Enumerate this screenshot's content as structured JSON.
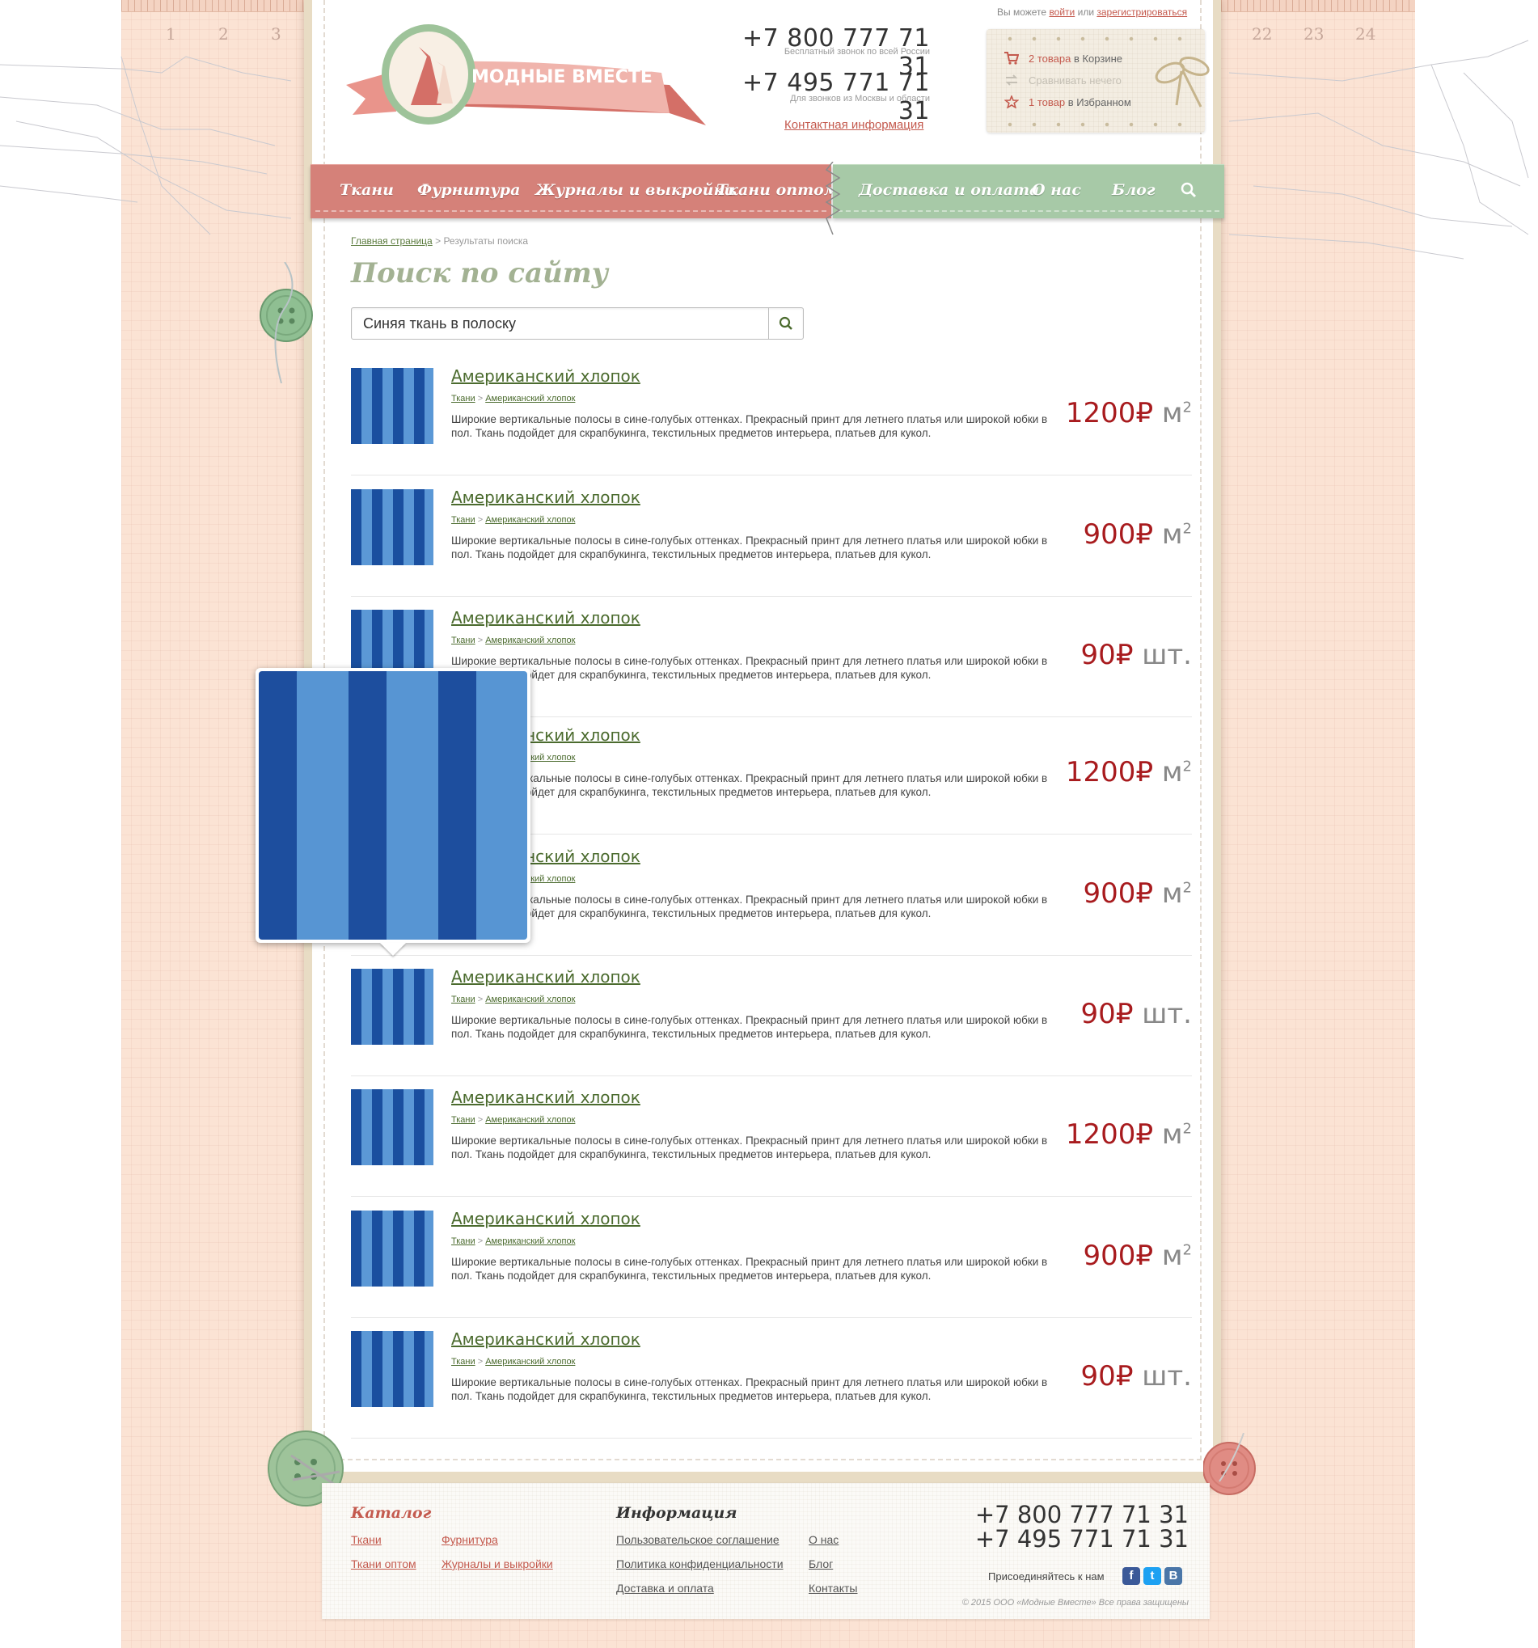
{
  "ruler": {
    "numbers": [
      "1",
      "2",
      "3",
      "22",
      "23",
      "24"
    ]
  },
  "header": {
    "brand": "МОДНЫЕ ВМЕСТЕ",
    "phone1": "+7 800 777 71 31",
    "phone1_note": "Бесплатный звонок по всей России",
    "phone2": "+7 495 771 71 31",
    "phone2_note": "Для звонков из Москвы и области",
    "contact_link": "Контактная информация",
    "auth_prefix": "Вы можете",
    "auth_login": "войти",
    "auth_or": "или",
    "auth_register": "зарегистрироваться"
  },
  "minipanel": {
    "cart_count": "2 товара",
    "cart_text": "в Корзине",
    "compare_text": "Сравнивать нечего",
    "fav_count": "1 товар",
    "fav_text": "в Избранном"
  },
  "nav": {
    "left": [
      "Ткани",
      "Фурнитура",
      "Журналы и выкройки",
      "Ткани оптом"
    ],
    "right": [
      "Доставка и оплата",
      "О нас",
      "Блог"
    ]
  },
  "breadcrumb": {
    "home": "Главная страница",
    "sep": ">",
    "current": "Результаты поиска"
  },
  "page_title": "Поиск по сайту",
  "search": {
    "value": "Синяя ткань в полоску"
  },
  "results": [
    {
      "title": "Американский хлопок",
      "crumb_a": "Ткани",
      "crumb_b": "Американский хлопок",
      "desc": "Широкие вертикальные полосы в сине-голубых оттенках. Прекрасный принт для летнего платья или широкой юбки в пол. Ткань подойдет для скрапбукинга, текстильных предметов интерьера, платьев для кукол.",
      "price": "1200",
      "currency": "₽",
      "unit": "м",
      "unit_sup": "2"
    },
    {
      "title": "Американский хлопок",
      "crumb_a": "Ткани",
      "crumb_b": "Американский хлопок",
      "desc": "Широкие вертикальные полосы в сине-голубых оттенках. Прекрасный принт для летнего платья или широкой юбки в пол. Ткань подойдет для скрапбукинга, текстильных предметов интерьера, платьев для кукол.",
      "price": "900",
      "currency": "₽",
      "unit": "м",
      "unit_sup": "2"
    },
    {
      "title": "Американский хлопок",
      "crumb_a": "Ткани",
      "crumb_b": "Американский хлопок",
      "desc": "Широкие вертикальные полосы в сине-голубых оттенках. Прекрасный принт для летнего платья или широкой юбки в пол. Ткань подойдет для скрапбукинга, текстильных предметов интерьера, платьев для кукол.",
      "price": "90",
      "currency": "₽",
      "unit": "шт.",
      "unit_sup": ""
    },
    {
      "title": "Американский хлопок",
      "crumb_a": "Ткани",
      "crumb_b": "Американский хлопок",
      "desc": "Широкие вертикальные полосы в сине-голубых оттенках. Прекрасный принт для летнего платья или широкой юбки в пол. Ткань подойдет для скрапбукинга, текстильных предметов интерьера, платьев для кукол.",
      "price": "1200",
      "currency": "₽",
      "unit": "м",
      "unit_sup": "2"
    },
    {
      "title": "Американский хлопок",
      "crumb_a": "Ткани",
      "crumb_b": "Американский хлопок",
      "desc": "Широкие вертикальные полосы в сине-голубых оттенках. Прекрасный принт для летнего платья или широкой юбки в пол. Ткань подойдет для скрапбукинга, текстильных предметов интерьера, платьев для кукол.",
      "price": "900",
      "currency": "₽",
      "unit": "м",
      "unit_sup": "2"
    },
    {
      "title": "Американский хлопок",
      "crumb_a": "Ткани",
      "crumb_b": "Американский хлопок",
      "desc": "Широкие вертикальные полосы в сине-голубых оттенках. Прекрасный принт для летнего платья или широкой юбки в пол. Ткань подойдет для скрапбукинга, текстильных предметов интерьера, платьев для кукол.",
      "price": "90",
      "currency": "₽",
      "unit": "шт.",
      "unit_sup": ""
    },
    {
      "title": "Американский хлопок",
      "crumb_a": "Ткани",
      "crumb_b": "Американский хлопок",
      "desc": "Широкие вертикальные полосы в сине-голубых оттенках. Прекрасный принт для летнего платья или широкой юбки в пол. Ткань подойдет для скрапбукинга, текстильных предметов интерьера, платьев для кукол.",
      "price": "1200",
      "currency": "₽",
      "unit": "м",
      "unit_sup": "2"
    },
    {
      "title": "Американский хлопок",
      "crumb_a": "Ткани",
      "crumb_b": "Американский хлопок",
      "desc": "Широкие вертикальные полосы в сине-голубых оттенках. Прекрасный принт для летнего платья или широкой юбки в пол. Ткань подойдет для скрапбукинга, текстильных предметов интерьера, платьев для кукол.",
      "price": "900",
      "currency": "₽",
      "unit": "м",
      "unit_sup": "2"
    },
    {
      "title": "Американский хлопок",
      "crumb_a": "Ткани",
      "crumb_b": "Американский хлопок",
      "desc": "Широкие вертикальные полосы в сине-голубых оттенках. Прекрасный принт для летнего платья или широкой юбки в пол. Ткань подойдет для скрапбукинга, текстильных предметов интерьера, платьев для кукол.",
      "price": "90",
      "currency": "₽",
      "unit": "шт.",
      "unit_sup": ""
    }
  ],
  "footer": {
    "catalog_head": "Каталог",
    "catalog_links": [
      "Ткани",
      "Фурнитура",
      "Ткани оптом",
      "Журналы и выкройки"
    ],
    "info_head": "Информация",
    "info_links": [
      "Пользовательское соглашение",
      "Политика конфиденциальности",
      "Доставка и оплата",
      "О нас",
      "Блог",
      "Контакты"
    ],
    "phone1": "+7 800 777 71 31",
    "phone2": "+7 495 771 71 31",
    "social_label": "Присоединяйтесь к нам",
    "copyright": "© 2015 ООО «Модные Вместе» Все права защищены"
  },
  "colors": {
    "accent_red": "#c45a4e",
    "price_red": "#a81b1e",
    "nav_pink": "#d58179",
    "nav_green": "#a7c9a7",
    "link_green": "#4b6b2e"
  },
  "icons": [
    "cart-icon",
    "compare-icon",
    "star-icon",
    "search-icon",
    "facebook-icon",
    "twitter-icon",
    "vk-icon"
  ]
}
